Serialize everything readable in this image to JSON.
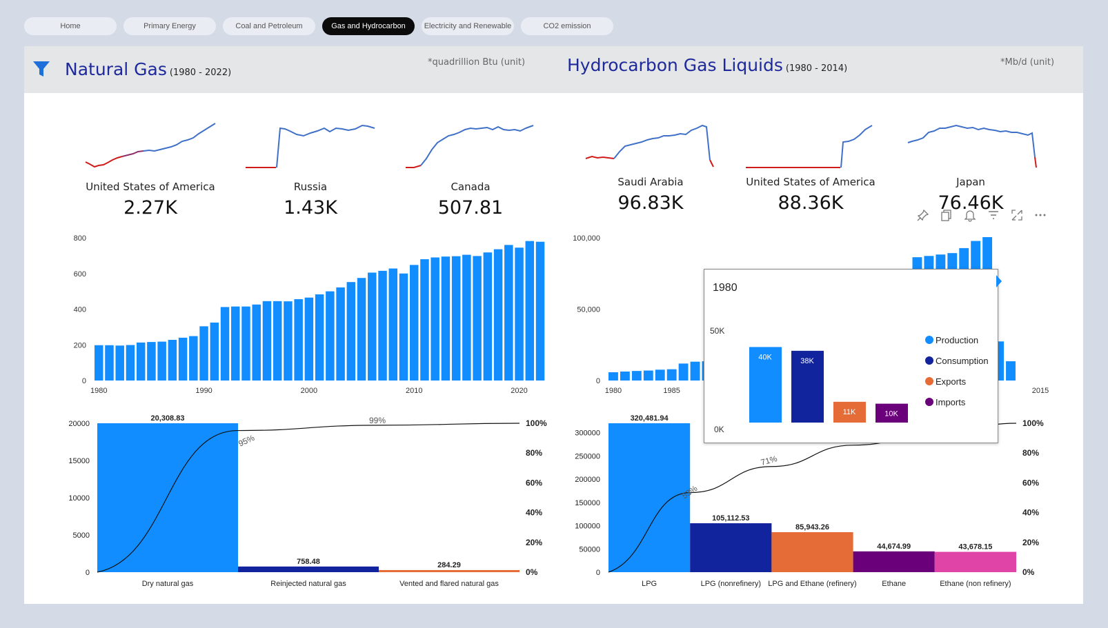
{
  "tabs": [
    {
      "label": "Home",
      "active": false
    },
    {
      "label": "Primary Energy",
      "active": false
    },
    {
      "label": "Coal and Petroleum",
      "active": false
    },
    {
      "label": "Gas and Hydrocarbon",
      "active": true
    },
    {
      "label": "Electricity and Renewable",
      "active": false
    },
    {
      "label": "CO2 emission",
      "active": false
    }
  ],
  "header": {
    "filter_icon": "funnel-icon",
    "ng_title": "Natural Gas",
    "ng_period": "(1980 -  2022)",
    "ng_unit": "*quadrillion Btu (unit)",
    "hgl_title": "Hydrocarbon Gas Liquids",
    "hgl_period": "(1980 -  2014)",
    "hgl_unit": "*Mb/d (unit)"
  },
  "ng_kpis": [
    {
      "country": "United States of America",
      "value": "2.27K"
    },
    {
      "country": "Russia",
      "value": "1.43K"
    },
    {
      "country": "Canada",
      "value": "507.81"
    }
  ],
  "hgl_kpis": [
    {
      "country": "Saudi Arabia",
      "value": "96.83K"
    },
    {
      "country": "United States of America",
      "value": "88.36K"
    },
    {
      "country": "Japan",
      "value": "76.46K"
    }
  ],
  "visual_header_icons": [
    "pin-icon",
    "copy-icon",
    "bell-icon",
    "filter-lines-icon",
    "expand-icon",
    "more-options-icon"
  ],
  "tooltip": {
    "year": "1980",
    "y_top": "50K",
    "y_bottom": "0K",
    "bars": [
      {
        "label": "40K",
        "value": 40,
        "color": "#118dff"
      },
      {
        "label": "38K",
        "value": 38,
        "color": "#12239e"
      },
      {
        "label": "11K",
        "value": 11,
        "color": "#e66c37"
      },
      {
        "label": "10K",
        "value": 10,
        "color": "#6b007b"
      }
    ],
    "legend": [
      {
        "label": "Production",
        "color": "#118dff"
      },
      {
        "label": "Consumption",
        "color": "#12239e"
      },
      {
        "label": "Exports",
        "color": "#e66c37"
      },
      {
        "label": "Imports",
        "color": "#6b007b"
      }
    ]
  },
  "chart_data": [
    {
      "id": "ng_bars",
      "type": "bar",
      "x": [
        1980,
        1981,
        1982,
        1983,
        1984,
        1985,
        1986,
        1987,
        1988,
        1989,
        1990,
        1991,
        1992,
        1993,
        1994,
        1995,
        1996,
        1997,
        1998,
        1999,
        2000,
        2001,
        2002,
        2003,
        2004,
        2005,
        2006,
        2007,
        2008,
        2009,
        2010,
        2011,
        2012,
        2013,
        2014,
        2015,
        2016,
        2017,
        2018,
        2019,
        2020,
        2021,
        2022
      ],
      "values": [
        198,
        198,
        196,
        199,
        213,
        216,
        218,
        228,
        240,
        249,
        304,
        325,
        412,
        415,
        415,
        426,
        445,
        445,
        444,
        456,
        465,
        483,
        500,
        522,
        552,
        575,
        605,
        615,
        628,
        600,
        648,
        680,
        690,
        695,
        697,
        705,
        698,
        718,
        736,
        760,
        745,
        782,
        778
      ],
      "xticks": [
        "1980",
        "1990",
        "2000",
        "2010",
        "2020"
      ],
      "ylim": [
        0,
        800
      ],
      "yticks": [
        "0",
        "200",
        "400",
        "600",
        "800"
      ]
    },
    {
      "id": "hgl_bars",
      "type": "bar",
      "x": [
        1980,
        1981,
        1982,
        1983,
        1984,
        1985,
        1986,
        1987,
        1988,
        1989,
        1990,
        1991,
        1992,
        1993,
        1994,
        1995,
        1996,
        1997,
        1998,
        1999,
        2000,
        2001,
        2002,
        2003,
        2004,
        2005,
        2006,
        2007,
        2008,
        2009,
        2010,
        2011,
        2012,
        2013,
        2014
      ],
      "values": [
        5800,
        6300,
        6700,
        7000,
        7600,
        7900,
        11900,
        13200,
        13500,
        14000,
        14500,
        15000,
        15500,
        16000,
        16500,
        17000,
        17500,
        18000,
        18500,
        19000,
        19500,
        20000,
        20500,
        21000,
        21500,
        22000,
        86400,
        87300,
        88300,
        89300,
        92800,
        97800,
        100500,
        27400,
        13500
      ],
      "xticks": [
        "1980",
        "1985",
        "2015"
      ],
      "ylim": [
        0,
        100000
      ],
      "yticks": [
        "0",
        "50,000",
        "100,000"
      ]
    },
    {
      "id": "ng_pareto",
      "type": "bar",
      "categories": [
        "Dry natural gas",
        "Reinjected natural gas",
        "Vented and flared natural gas"
      ],
      "values": [
        20308.83,
        758.48,
        284.29
      ],
      "value_labels": [
        "20,308.83",
        "758.48",
        "284.29"
      ],
      "colors": [
        "#118dff",
        "#12239e",
        "#e66c37"
      ],
      "cumulative_labels": [
        "95%",
        "99%"
      ],
      "ylim": [
        0,
        20000
      ],
      "yticks": [
        "0",
        "5000",
        "10000",
        "15000",
        "20000"
      ],
      "y2ticks": [
        "0%",
        "20%",
        "40%",
        "60%",
        "80%",
        "100%"
      ]
    },
    {
      "id": "hgl_pareto",
      "type": "bar",
      "categories": [
        "LPG",
        "LPG (nonrefinery)",
        "LPG and Ethane (refinery)",
        "Ethane",
        "Ethane (non refinery)"
      ],
      "values": [
        320481.94,
        105112.53,
        85943.26,
        44674.99,
        43678.15
      ],
      "value_labels": [
        "320,481.94",
        "105,112.53",
        "85,943.26",
        "44,674.99",
        "43,678.15"
      ],
      "colors": [
        "#118dff",
        "#12239e",
        "#e66c37",
        "#6b007b",
        "#e044a7"
      ],
      "cumulative_labels": [
        "53%",
        "71%"
      ],
      "ylim": [
        0,
        320000
      ],
      "yticks": [
        "0",
        "50000",
        "100000",
        "150000",
        "200000",
        "250000",
        "300000"
      ],
      "y2ticks": [
        "0%",
        "20%",
        "40%",
        "60%",
        "80%",
        "100%"
      ]
    }
  ]
}
